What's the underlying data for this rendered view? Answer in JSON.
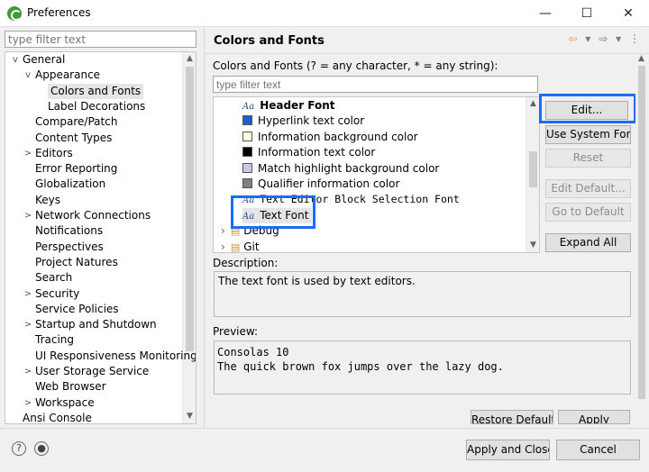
{
  "window": {
    "title": "Preferences",
    "minimize": "—",
    "maximize": "☐",
    "close": "✕"
  },
  "left": {
    "filter_placeholder": "type filter text",
    "tree": [
      {
        "label": "General",
        "expander": "v"
      },
      {
        "label": "Appearance",
        "expander": "v"
      },
      {
        "label": "Colors and Fonts",
        "expander": ""
      },
      {
        "label": "Label Decorations",
        "expander": ""
      },
      {
        "label": "Compare/Patch",
        "expander": ""
      },
      {
        "label": "Content Types",
        "expander": ""
      },
      {
        "label": "Editors",
        "expander": ">"
      },
      {
        "label": "Error Reporting",
        "expander": ""
      },
      {
        "label": "Globalization",
        "expander": ""
      },
      {
        "label": "Keys",
        "expander": ""
      },
      {
        "label": "Network Connections",
        "expander": ">"
      },
      {
        "label": "Notifications",
        "expander": ""
      },
      {
        "label": "Perspectives",
        "expander": ""
      },
      {
        "label": "Project Natures",
        "expander": ""
      },
      {
        "label": "Search",
        "expander": ""
      },
      {
        "label": "Security",
        "expander": ">"
      },
      {
        "label": "Service Policies",
        "expander": ""
      },
      {
        "label": "Startup and Shutdown",
        "expander": ">"
      },
      {
        "label": "Tracing",
        "expander": ""
      },
      {
        "label": "UI Responsiveness Monitoring",
        "expander": ""
      },
      {
        "label": "User Storage Service",
        "expander": ">"
      },
      {
        "label": "Web Browser",
        "expander": ""
      },
      {
        "label": "Workspace",
        "expander": ">"
      },
      {
        "label": "Ansi Console",
        "expander": ""
      }
    ]
  },
  "right": {
    "title": "Colors and Fonts",
    "hint": "Colors and Fonts (? = any character, * = any string):",
    "filter_placeholder": "type filter text",
    "tree": [
      {
        "label": "Header Font",
        "kind": "font-bold",
        "color": ""
      },
      {
        "label": "Hyperlink text color",
        "kind": "color",
        "color": "#1a5fc7"
      },
      {
        "label": "Information background color",
        "kind": "color",
        "color": "#ffffe1"
      },
      {
        "label": "Information text color",
        "kind": "color",
        "color": "#000000"
      },
      {
        "label": "Match highlight background color",
        "kind": "color",
        "color": "#cbc6e8"
      },
      {
        "label": "Qualifier information color",
        "kind": "color",
        "color": "#808080"
      },
      {
        "label": "Text Editor Block Selection Font",
        "kind": "font-mono",
        "color": ""
      },
      {
        "label": "Text Font",
        "kind": "font-selected",
        "color": ""
      },
      {
        "label": "Debug",
        "kind": "category",
        "color": ""
      },
      {
        "label": "Git",
        "kind": "category",
        "color": ""
      }
    ],
    "buttons": {
      "edit": "Edit...",
      "use_system_font": "Use System Font",
      "reset": "Reset",
      "edit_default": "Edit Default...",
      "go_to_default": "Go to Default",
      "expand_all": "Expand All"
    },
    "description_label": "Description:",
    "description": "The text font is used by text editors.",
    "preview_label": "Preview:",
    "preview_line1": "Consolas 10",
    "preview_line2": "The quick brown fox jumps over the lazy dog.",
    "restore_defaults": "Restore Defaults",
    "apply": "Apply"
  },
  "footer": {
    "help_icon": "?",
    "apply_and_close": "Apply and Close",
    "cancel": "Cancel"
  },
  "colors": {
    "highlight": "#1b6ef3"
  }
}
